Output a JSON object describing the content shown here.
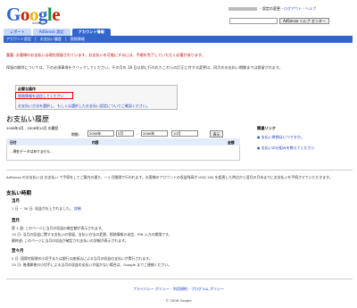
{
  "logo": {
    "text": "Google",
    "sub": "AdSense"
  },
  "top_links": {
    "redacted": "user-email",
    "text": "- 設定の変更 -",
    "logout": "ログアウト",
    "help": "- ヘルプ"
  },
  "search": {
    "value": "",
    "button": "AdSense ヘルプ センター"
  },
  "tabs": [
    {
      "label": "レポート",
      "active": false
    },
    {
      "label": "AdSense 設定",
      "active": false
    },
    {
      "label": "アカウント情報",
      "active": true
    }
  ],
  "subnav": [
    "アカウント設定",
    "|",
    "お支払い履歴",
    "|",
    "税務情報"
  ],
  "warning": "重要: お客様のお支払いは現在保留されています。お支払いを可能にするには、手順を完了していただく必要があります。",
  "info": "保留の解除については、下の必須事項をクリックしてください。その月の 18 日以前に行われたこれらの訂正に付する変更は、同月のお支払い期間までは保留されます。",
  "action": {
    "title": "必要な操作",
    "link1": "税務情報を送信してください",
    "link2": "お支払い方法を選択し、もしくは選択したお支払い設定についてご確認ください。"
  },
  "history": {
    "title": "お支払い履歴",
    "range": "2006年5月 - 2006年10月 の履歴",
    "period_label": "期間:",
    "from_year": "2006年",
    "from_month": "5月",
    "to_year": "2006年",
    "to_month": "10月",
    "go": "表示",
    "col_date": "日付",
    "col_detail": "内容",
    "col_amount": "金額",
    "empty": "- 現在データはありません -"
  },
  "related": {
    "title": "関連リンク",
    "items": [
      "支払い時期はいつですか。",
      "支払いの仕組みを教えてください"
    ]
  },
  "note": "AdSense のお支払いは お支払い で手続をしてご案内の通り、一ヶ月間隔で行われます。お客様のアカウントの収益残高が USD 100 を超過した時点から翌月の月末までにお支払いを手続させていただきます。",
  "timing": {
    "title": "支払い時期",
    "m1_title": "当月",
    "m1_l1": "1 日 ~ 30 日: 収益が計上されました。",
    "m1_l1_link": "詳細",
    "m2_title": "翌月",
    "m2_l1": "第 1 週: このページに当月の収益の確定額が表示されます。",
    "m2_l2": "15 日: 当月の収益に関する支払いの保留、支払い方法の変更、税務情報の送信、PIN 入力の期限です。",
    "m2_l3": "最終週: このページに当月の収益が確定され支払いの詳細が表示されます。",
    "m3_title": "翌々月",
    "m3_l1": "5 日: 国際宅配便の小切手または銀行口座振込による当月の収益の支払いが実行されます。",
    "m3_l2": "25 日: 普通郵便の小切手による当月の収益の支払いが届かない場合は、Google までご連絡ください。"
  },
  "footer": {
    "links": "プライバシー ポリシー - 利用規約 - プログラム ポリシー",
    "copy": "© 2006 Google"
  }
}
